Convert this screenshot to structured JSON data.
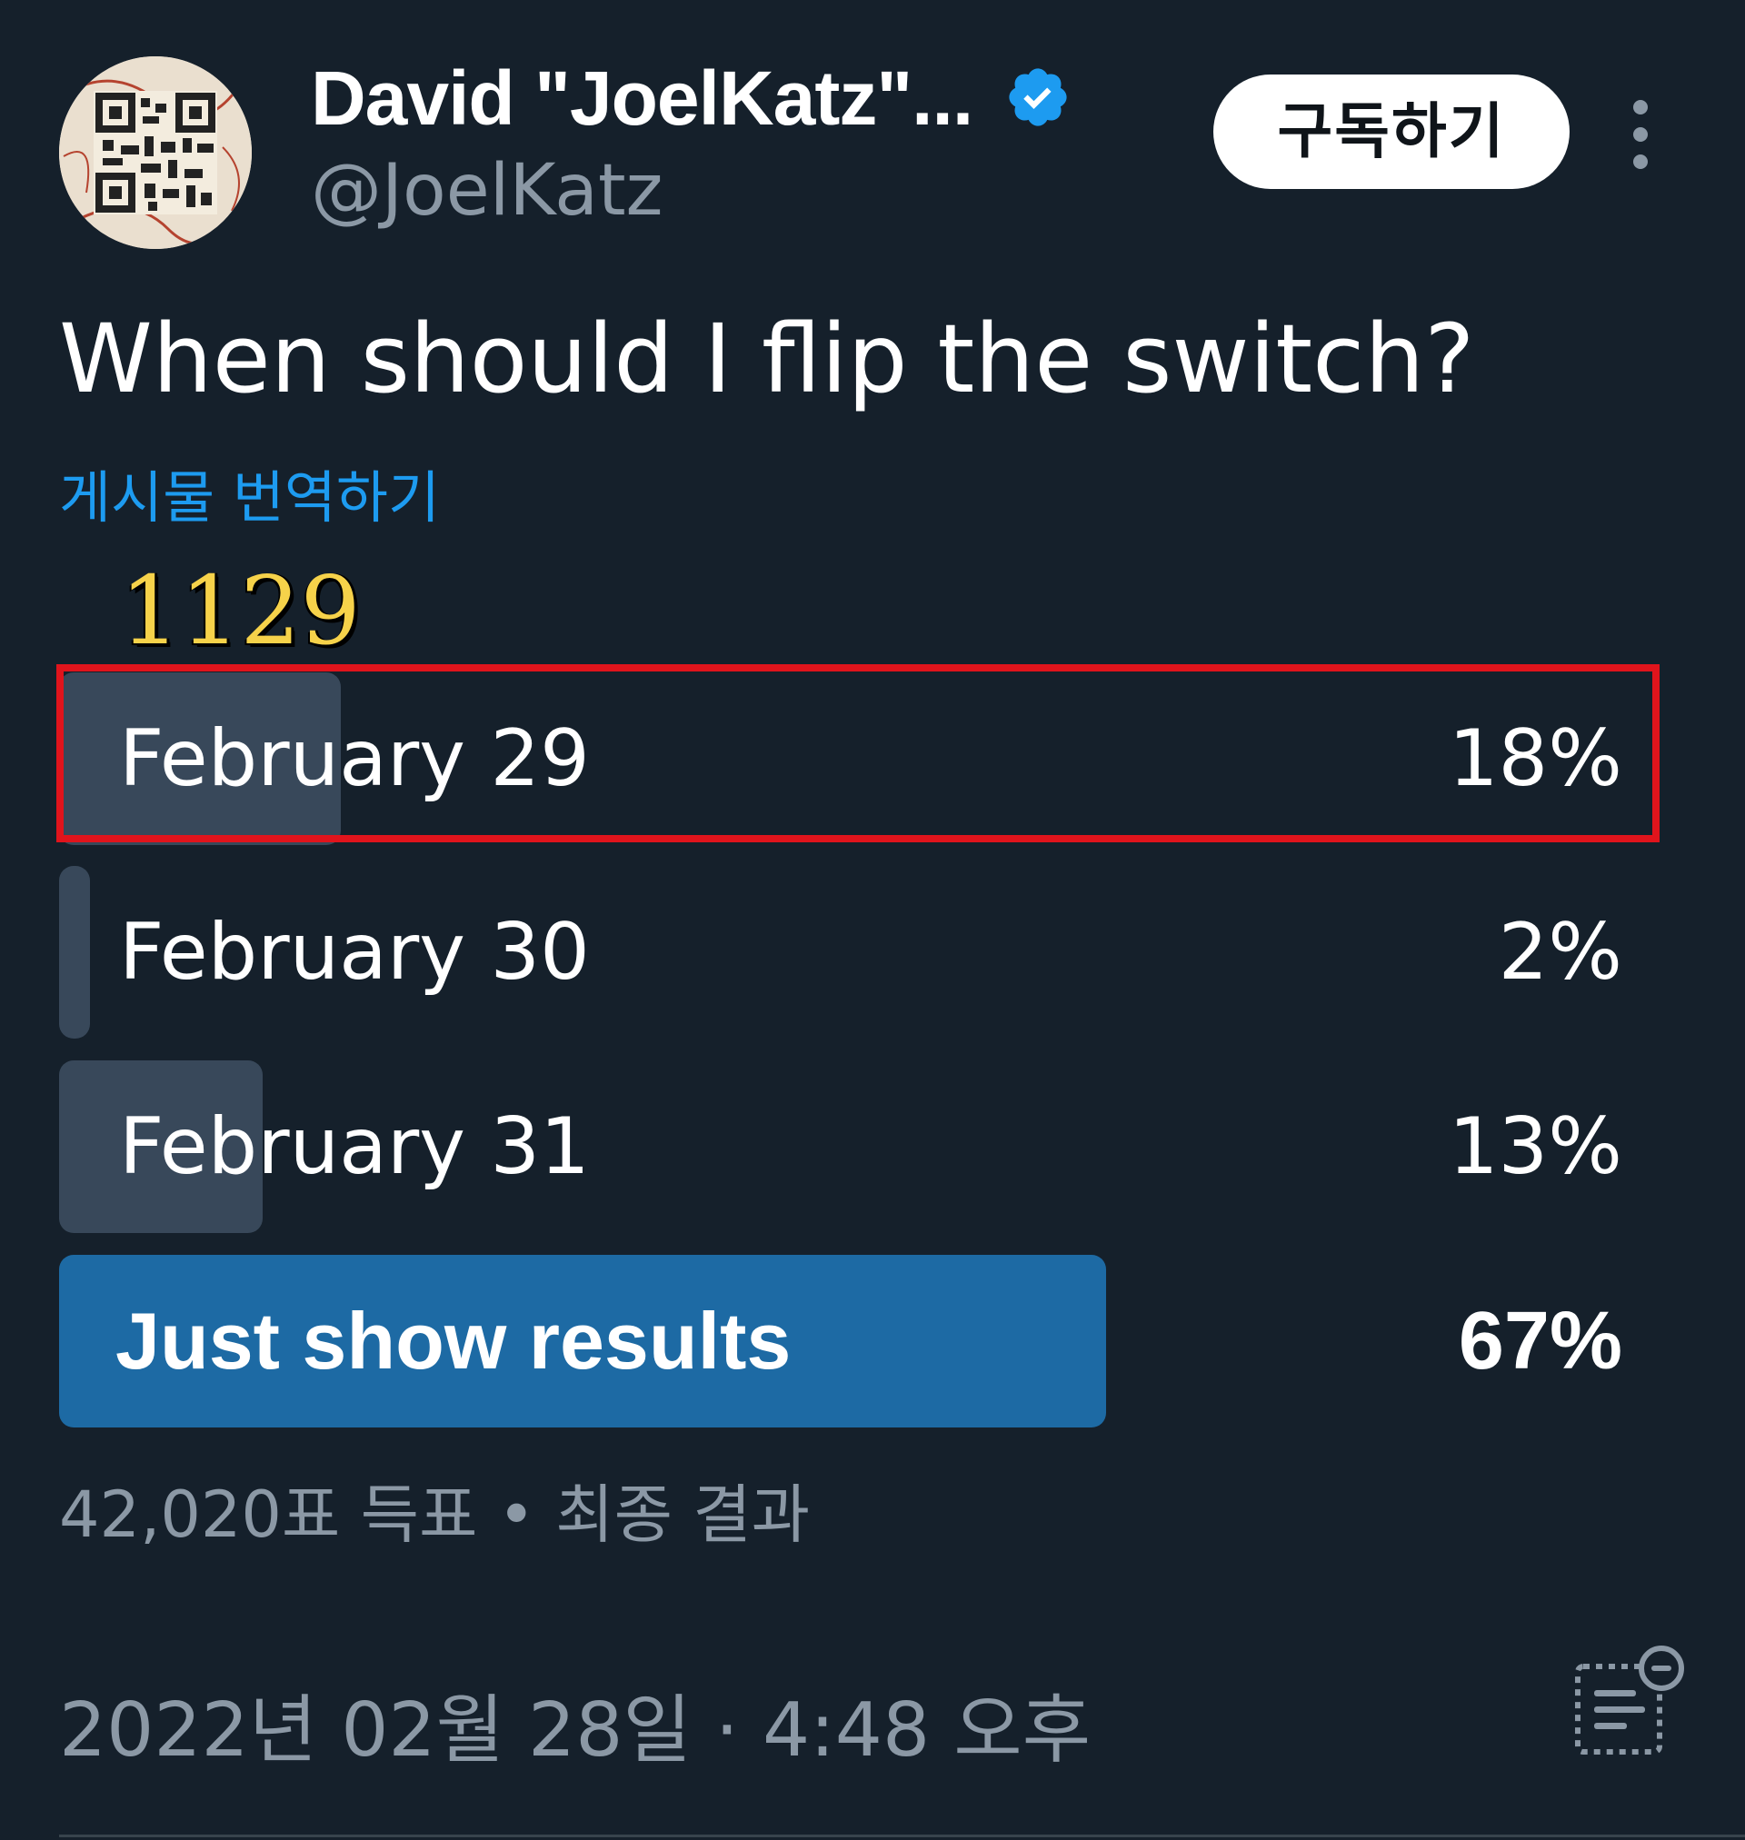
{
  "author": {
    "display_name": "David \"JoelKatz\"...",
    "handle": "@JoelKatz",
    "verified": true,
    "avatar_icon": "qr-code-avatar"
  },
  "header": {
    "subscribe_label": "구독하기",
    "more_icon": "more-vertical-icon"
  },
  "post": {
    "text": "When should I flip the switch?",
    "translate_label": "게시물 번역하기",
    "overlay_number": "1129"
  },
  "poll": {
    "options": [
      {
        "label": "February 29",
        "percent_text": "18%",
        "fraction": 0.18,
        "winner": false,
        "highlighted": true
      },
      {
        "label": "February 30",
        "percent_text": "2%",
        "fraction": 0.02,
        "winner": false,
        "highlighted": false
      },
      {
        "label": "February 31",
        "percent_text": "13%",
        "fraction": 0.13,
        "winner": false,
        "highlighted": false
      },
      {
        "label": "Just show results",
        "percent_text": "67%",
        "fraction": 0.67,
        "winner": true,
        "highlighted": false
      }
    ],
    "meta": "42,020표 득표 • 최종 결과"
  },
  "footer": {
    "timestamp": "2022년 02월 28일 · 4:48 오후",
    "notes_icon": "community-notes-icon"
  },
  "colors": {
    "background": "#15202b",
    "accent": "#1d9bf0",
    "poll_fill": "#38485a",
    "poll_winner_fill": "#1d6aa4",
    "highlight_border": "#e0141c",
    "secondary_text": "#8b98a5"
  }
}
